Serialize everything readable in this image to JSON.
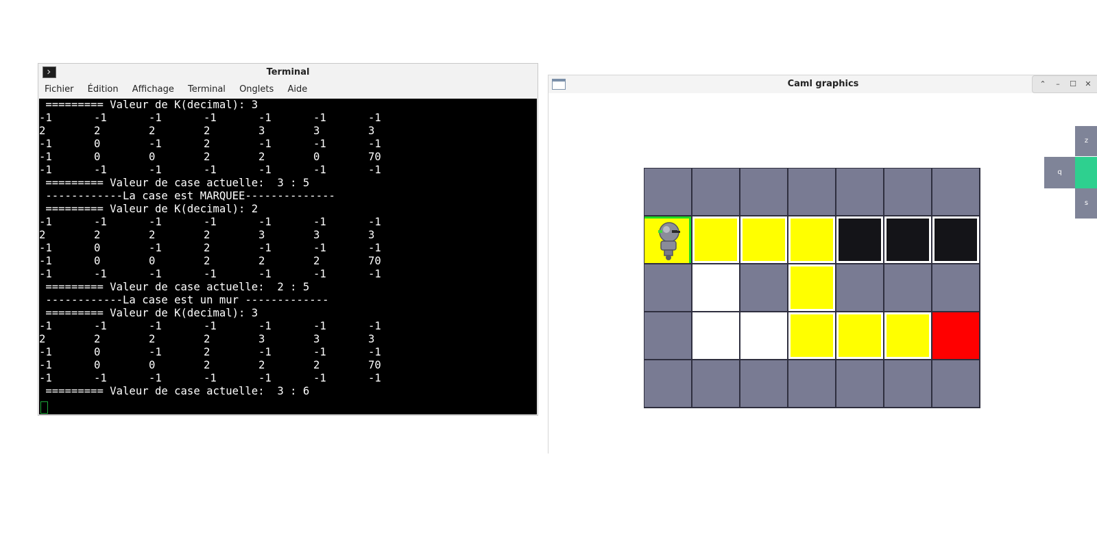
{
  "terminal": {
    "title": "Terminal",
    "menu": [
      "Fichier",
      "Édition",
      "Affichage",
      "Terminal",
      "Onglets",
      "Aide"
    ],
    "lines": [
      {
        "text": " ========= Valeur de K(decimal): 3"
      },
      {
        "cells": [
          "-1",
          "-1",
          "-1",
          "-1",
          "-1",
          "-1",
          "-1"
        ]
      },
      {
        "cells": [
          "2",
          "2",
          "2",
          "2",
          "3",
          "3",
          "3"
        ]
      },
      {
        "cells": [
          "-1",
          "0",
          "-1",
          "2",
          "-1",
          "-1",
          "-1"
        ]
      },
      {
        "cells": [
          "-1",
          "0",
          "0",
          "2",
          "2",
          "0",
          "70"
        ]
      },
      {
        "cells": [
          "-1",
          "-1",
          "-1",
          "-1",
          "-1",
          "-1",
          "-1"
        ]
      },
      {
        "text": " ========= Valeur de case actuelle:  3 : 5"
      },
      {
        "text": " ------------La case est MARQUEE--------------"
      },
      {
        "text": " ========= Valeur de K(decimal): 2"
      },
      {
        "cells": [
          "-1",
          "-1",
          "-1",
          "-1",
          "-1",
          "-1",
          "-1"
        ]
      },
      {
        "cells": [
          "2",
          "2",
          "2",
          "2",
          "3",
          "3",
          "3"
        ]
      },
      {
        "cells": [
          "-1",
          "0",
          "-1",
          "2",
          "-1",
          "-1",
          "-1"
        ]
      },
      {
        "cells": [
          "-1",
          "0",
          "0",
          "2",
          "2",
          "2",
          "70"
        ]
      },
      {
        "cells": [
          "-1",
          "-1",
          "-1",
          "-1",
          "-1",
          "-1",
          "-1"
        ]
      },
      {
        "text": " ========= Valeur de case actuelle:  2 : 5"
      },
      {
        "text": " ------------La case est un mur -------------"
      },
      {
        "text": " ========= Valeur de K(decimal): 3"
      },
      {
        "cells": [
          "-1",
          "-1",
          "-1",
          "-1",
          "-1",
          "-1",
          "-1"
        ]
      },
      {
        "cells": [
          "2",
          "2",
          "2",
          "2",
          "3",
          "3",
          "3"
        ]
      },
      {
        "cells": [
          "-1",
          "0",
          "-1",
          "2",
          "-1",
          "-1",
          "-1"
        ]
      },
      {
        "cells": [
          "-1",
          "0",
          "0",
          "2",
          "2",
          "2",
          "70"
        ]
      },
      {
        "cells": [
          "-1",
          "-1",
          "-1",
          "-1",
          "-1",
          "-1",
          "-1"
        ]
      },
      {
        "text": " ========= Valeur de case actuelle:  3 : 6"
      }
    ]
  },
  "caml": {
    "title": "Caml graphics",
    "window_buttons": [
      "⌃",
      "–",
      "☐",
      "✕"
    ],
    "colors": {
      "wall": "#797b93",
      "path": "#ffff00",
      "black": "#141418",
      "empty": "#ffffff",
      "goal": "#ff0000",
      "grid_line": "#2e2e3e",
      "current_border": "#22dd22"
    },
    "board": [
      [
        "wall",
        "wall",
        "wall",
        "wall",
        "wall",
        "wall",
        "wall"
      ],
      [
        "current",
        "path",
        "path",
        "path",
        "black",
        "black",
        "black"
      ],
      [
        "wall",
        "empty",
        "wall",
        "path",
        "wall",
        "wall",
        "wall"
      ],
      [
        "wall",
        "empty",
        "empty",
        "path",
        "path",
        "path",
        "goal"
      ],
      [
        "wall",
        "wall",
        "wall",
        "wall",
        "wall",
        "wall",
        "wall"
      ]
    ],
    "controls": {
      "up": "z",
      "left": "q",
      "down": "s",
      "up_color": "#7f8498",
      "left_color": "#7f8498",
      "down_color": "#7f8498",
      "center_color": "#2ed08f"
    }
  }
}
